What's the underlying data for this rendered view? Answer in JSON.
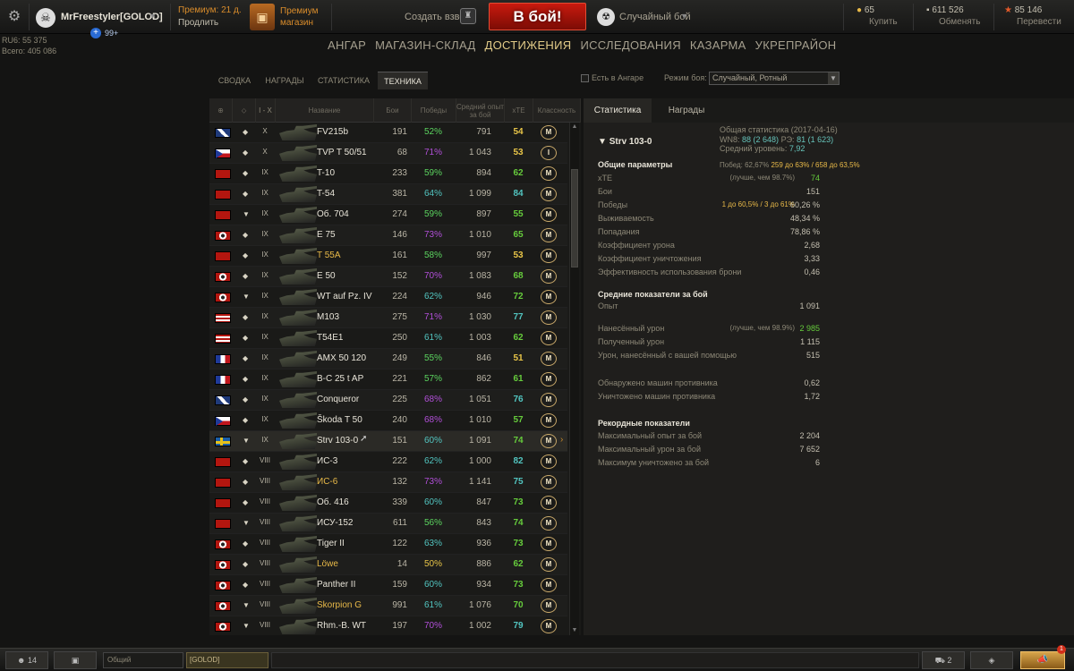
{
  "header": {
    "player_name": "MrFreestyler[GOLOD]",
    "badge_count": "99+",
    "premium_line1": "Премиум: 21 д.",
    "premium_line2": "Продлить",
    "premium_shop": "Премиум\nмагазин",
    "create_platoon": "Создать взвод",
    "battle_button": "В бой!",
    "battle_mode": "Случайный бой",
    "gold_value": "65",
    "gold_action": "Купить",
    "credits_value": "611 526",
    "credits_action": "Обменять",
    "freexp_value": "85 146",
    "freexp_action": "Перевести"
  },
  "account": {
    "line1": "RU6: 55 375",
    "line2": "Всего: 405 086"
  },
  "nav": [
    "АНГАР",
    "МАГАЗИН-СКЛАД",
    "ДОСТИЖЕНИЯ",
    "ИССЛЕДОВАНИЯ",
    "КАЗАРМА",
    "УКРЕПРАЙОН"
  ],
  "nav_active": "ДОСТИЖЕНИЯ",
  "subtabs": [
    "СВОДКА",
    "НАГРАДЫ",
    "СТАТИСТИКА",
    "ТЕХНИКА"
  ],
  "subtab_active": "ТЕХНИКА",
  "filters": {
    "in_hangar_label": "Есть в Ангаре",
    "mode_label": "Режим боя:",
    "mode_value": "Случайный, Ротный"
  },
  "table": {
    "headers": {
      "tier": "I - X",
      "name": "Название",
      "battles": "Бои",
      "wins": "Победы",
      "avg_xp": "Средний опыт за бой",
      "xte": "xTE",
      "mastery": "Классность"
    },
    "rows": [
      {
        "flag": "uk",
        "class": "◆",
        "tier": "X",
        "name": "FV215b",
        "battles": "191",
        "wins": "52%",
        "avg_xp": "791",
        "xte": "54",
        "mastery": "M",
        "gold": false
      },
      {
        "flag": "czech",
        "class": "◆",
        "tier": "X",
        "name": "TVP T 50/51",
        "battles": "68",
        "wins": "71%",
        "avg_xp": "1 043",
        "xte": "53",
        "mastery": "I",
        "gold": false
      },
      {
        "flag": "ussr",
        "class": "◆",
        "tier": "IX",
        "name": "T-10",
        "battles": "233",
        "wins": "59%",
        "avg_xp": "894",
        "xte": "62",
        "mastery": "M",
        "gold": false
      },
      {
        "flag": "ussr",
        "class": "◆",
        "tier": "IX",
        "name": "T-54",
        "battles": "381",
        "wins": "64%",
        "avg_xp": "1 099",
        "xte": "84",
        "mastery": "M",
        "gold": false
      },
      {
        "flag": "ussr",
        "class": "▼",
        "tier": "IX",
        "name": "Об. 704",
        "battles": "274",
        "wins": "59%",
        "avg_xp": "897",
        "xte": "55",
        "mastery": "M",
        "gold": false
      },
      {
        "flag": "germany",
        "class": "◆",
        "tier": "IX",
        "name": "E 75",
        "battles": "146",
        "wins": "73%",
        "avg_xp": "1 010",
        "xte": "65",
        "mastery": "M",
        "gold": false
      },
      {
        "flag": "ussr",
        "class": "◆",
        "tier": "IX",
        "name": "T 55A",
        "battles": "161",
        "wins": "58%",
        "avg_xp": "997",
        "xte": "53",
        "mastery": "M",
        "gold": true
      },
      {
        "flag": "germany",
        "class": "◆",
        "tier": "IX",
        "name": "E 50",
        "battles": "152",
        "wins": "70%",
        "avg_xp": "1 083",
        "xte": "68",
        "mastery": "M",
        "gold": false
      },
      {
        "flag": "germany",
        "class": "▼",
        "tier": "IX",
        "name": "WT auf Pz. IV",
        "battles": "224",
        "wins": "62%",
        "avg_xp": "946",
        "xte": "72",
        "mastery": "M",
        "gold": false
      },
      {
        "flag": "usa",
        "class": "◆",
        "tier": "IX",
        "name": "M103",
        "battles": "275",
        "wins": "71%",
        "avg_xp": "1 030",
        "xte": "77",
        "mastery": "M",
        "gold": false
      },
      {
        "flag": "usa",
        "class": "◆",
        "tier": "IX",
        "name": "T54E1",
        "battles": "250",
        "wins": "61%",
        "avg_xp": "1 003",
        "xte": "62",
        "mastery": "M",
        "gold": false
      },
      {
        "flag": "france",
        "class": "◆",
        "tier": "IX",
        "name": "AMX 50 120",
        "battles": "249",
        "wins": "55%",
        "avg_xp": "846",
        "xte": "51",
        "mastery": "M",
        "gold": false
      },
      {
        "flag": "france",
        "class": "◆",
        "tier": "IX",
        "name": "B-C 25 t AP",
        "battles": "221",
        "wins": "57%",
        "avg_xp": "862",
        "xte": "61",
        "mastery": "M",
        "gold": false
      },
      {
        "flag": "uk",
        "class": "◆",
        "tier": "IX",
        "name": "Conqueror",
        "battles": "225",
        "wins": "68%",
        "avg_xp": "1 051",
        "xte": "76",
        "mastery": "M",
        "gold": false
      },
      {
        "flag": "czech",
        "class": "◆",
        "tier": "IX",
        "name": "Škoda T 50",
        "battles": "240",
        "wins": "68%",
        "avg_xp": "1 010",
        "xte": "57",
        "mastery": "M",
        "gold": false
      },
      {
        "flag": "sweden",
        "class": "▼",
        "tier": "IX",
        "name": "Strv 103-0",
        "battles": "151",
        "wins": "60%",
        "avg_xp": "1 091",
        "xte": "74",
        "mastery": "M",
        "gold": false,
        "selected": true
      },
      {
        "flag": "ussr",
        "class": "◆",
        "tier": "VIII",
        "name": "ИС-3",
        "battles": "222",
        "wins": "62%",
        "avg_xp": "1 000",
        "xte": "82",
        "mastery": "M",
        "gold": false
      },
      {
        "flag": "ussr",
        "class": "◆",
        "tier": "VIII",
        "name": "ИС-6",
        "battles": "132",
        "wins": "73%",
        "avg_xp": "1 141",
        "xte": "75",
        "mastery": "M",
        "gold": true
      },
      {
        "flag": "ussr",
        "class": "◆",
        "tier": "VIII",
        "name": "Об. 416",
        "battles": "339",
        "wins": "60%",
        "avg_xp": "847",
        "xte": "73",
        "mastery": "M",
        "gold": false
      },
      {
        "flag": "ussr",
        "class": "▼",
        "tier": "VIII",
        "name": "ИСУ-152",
        "battles": "611",
        "wins": "56%",
        "avg_xp": "843",
        "xte": "74",
        "mastery": "M",
        "gold": false
      },
      {
        "flag": "germany",
        "class": "◆",
        "tier": "VIII",
        "name": "Tiger II",
        "battles": "122",
        "wins": "63%",
        "avg_xp": "936",
        "xte": "73",
        "mastery": "M",
        "gold": false
      },
      {
        "flag": "germany",
        "class": "◆",
        "tier": "VIII",
        "name": "Löwe",
        "battles": "14",
        "wins": "50%",
        "avg_xp": "886",
        "xte": "62",
        "mastery": "M",
        "gold": true
      },
      {
        "flag": "germany",
        "class": "◆",
        "tier": "VIII",
        "name": "Panther II",
        "battles": "159",
        "wins": "60%",
        "avg_xp": "934",
        "xte": "73",
        "mastery": "M",
        "gold": false
      },
      {
        "flag": "germany",
        "class": "▼",
        "tier": "VIII",
        "name": "Skorpion G",
        "battles": "991",
        "wins": "61%",
        "avg_xp": "1 076",
        "xte": "70",
        "mastery": "M",
        "gold": true
      },
      {
        "flag": "germany",
        "class": "▼",
        "tier": "VIII",
        "name": "Rhm.-B. WT",
        "battles": "197",
        "wins": "70%",
        "avg_xp": "1 002",
        "xte": "79",
        "mastery": "M",
        "gold": false
      }
    ]
  },
  "detail": {
    "tabs": [
      "Статистика",
      "Награды"
    ],
    "tank": "Strv 103-0",
    "summary": {
      "line1": "Общая статистика (2017-04-16)",
      "wn8_label": "WN8:",
      "wn8_value": "88 (2 648)",
      "ps_label": "РЭ:",
      "ps_value": "81 (1 623)",
      "avg_level_label": "Средний уровень:",
      "avg_level_value": "7,92"
    },
    "general_title": "Общие параметры",
    "general_wins_summary": "Побед: 62,67%",
    "general_wins_extra": "259 до 63% / 658 до 63,5%",
    "general": [
      {
        "label": "xTE",
        "extra": "(лучше, чем 98.7%)",
        "value": "74"
      },
      {
        "label": "Бои",
        "extra": "",
        "value": "151"
      },
      {
        "label": "Победы",
        "extra": "1 до 60,5% / 3 до 61%",
        "value": "60,26 %"
      },
      {
        "label": "Выживаемость",
        "extra": "",
        "value": "48,34 %"
      },
      {
        "label": "Попадания",
        "extra": "",
        "value": "78,86 %"
      },
      {
        "label": "Коэффициент урона",
        "extra": "",
        "value": "2,68"
      },
      {
        "label": "Коэффициент уничтожения",
        "extra": "",
        "value": "3,33"
      },
      {
        "label": "Эффективность использования брони",
        "extra": "",
        "value": "0,46"
      }
    ],
    "avg_title": "Средние показатели за бой",
    "avg": [
      {
        "label": "Опыт",
        "extra": "",
        "value": "1 091"
      },
      {
        "label": "Нанесённый урон",
        "extra": "(лучше, чем 98.9%)",
        "value": "2 985"
      },
      {
        "label": "Полученный урон",
        "extra": "",
        "value": "1 115"
      },
      {
        "label": "Урон, нанесённый с вашей помощью",
        "extra": "",
        "value": "515"
      },
      {
        "label": "Обнаружено машин противника",
        "extra": "",
        "value": "0,62"
      },
      {
        "label": "Уничтожено машин противника",
        "extra": "",
        "value": "1,72"
      }
    ],
    "record_title": "Рекордные показатели",
    "record": [
      {
        "label": "Максимальный опыт за бой",
        "value": "2 204"
      },
      {
        "label": "Максимальный урон за бой",
        "value": "7 652"
      },
      {
        "label": "Максимум уничтожено за бой",
        "value": "6"
      }
    ]
  },
  "bottom": {
    "friends_count": "14",
    "chat_channel": "Общий",
    "clan_channel": "[GOLOD]",
    "squad_count": "2",
    "notification_count": "1"
  },
  "colors": {
    "wins_purple": "#b14fd8",
    "wins_green": "#5bd45f",
    "wins_teal": "#52c5c0",
    "wins_yellow": "#e8c548",
    "xte_green": "#66cc3c",
    "xte_teal": "#52c5c0",
    "xte_yellow": "#e8c548",
    "gold_name": "#e8b948"
  }
}
